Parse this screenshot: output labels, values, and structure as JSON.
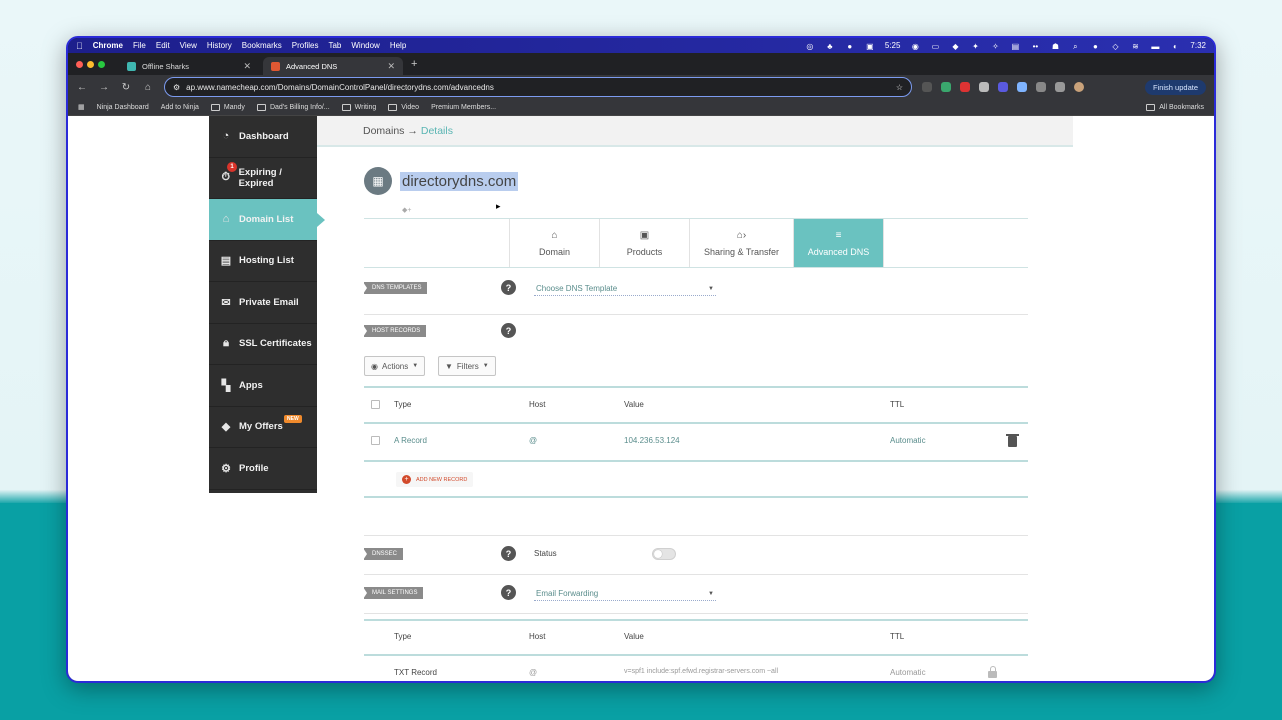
{
  "mac_menu": {
    "app": "Chrome",
    "items": [
      "File",
      "Edit",
      "View",
      "History",
      "Bookmarks",
      "Profiles",
      "Tab",
      "Window",
      "Help"
    ],
    "battery_time": "5:25",
    "clock": "7:32"
  },
  "browser": {
    "tabs": [
      {
        "title": "Offline Sharks",
        "active": false
      },
      {
        "title": "Advanced DNS",
        "active": true
      }
    ],
    "url": "ap.www.namecheap.com/Domains/DomainControlPanel/directorydns.com/advancedns",
    "finish_update": "Finish update",
    "bookmarks": [
      "Ninja Dashboard",
      "Add to Ninja",
      "Mandy",
      "Dad's Billing Info/...",
      "Writing",
      "Video",
      "Premium Members..."
    ],
    "all_bookmarks": "All Bookmarks"
  },
  "sidebar": {
    "items": [
      {
        "label": "Dashboard",
        "icon": "gauge-icon"
      },
      {
        "label": "Expiring / Expired",
        "icon": "timer-icon",
        "badge": "1"
      },
      {
        "label": "Domain List",
        "icon": "home-icon",
        "active": true
      },
      {
        "label": "Hosting List",
        "icon": "server-icon"
      },
      {
        "label": "Private Email",
        "icon": "envelope-icon"
      },
      {
        "label": "SSL Certificates",
        "icon": "lock-icon"
      },
      {
        "label": "Apps",
        "icon": "apps-icon"
      },
      {
        "label": "My Offers",
        "icon": "tag-icon",
        "badge": "NEW"
      },
      {
        "label": "Profile",
        "icon": "gear-icon"
      }
    ]
  },
  "header": {
    "breadcrumb_root": "Domains →",
    "breadcrumb_current": "Details"
  },
  "domain": {
    "name": "directorydns.com"
  },
  "domain_tabs": [
    {
      "label": "Domain",
      "icon": "home-icon"
    },
    {
      "label": "Products",
      "icon": "box-icon"
    },
    {
      "label": "Sharing & Transfer",
      "icon": "share-icon"
    },
    {
      "label": "Advanced DNS",
      "icon": "server-stack-icon",
      "active": true
    }
  ],
  "dns_templates": {
    "label": "DNS TEMPLATES",
    "select_value": "Choose DNS Template"
  },
  "host_records": {
    "label": "HOST RECORDS",
    "actions_label": "Actions",
    "filters_label": "Filters",
    "columns": [
      "Type",
      "Host",
      "Value",
      "TTL"
    ],
    "rows": [
      {
        "type": "A Record",
        "host": "@",
        "value": "104.236.53.124",
        "ttl": "Automatic"
      }
    ],
    "add_new": "ADD NEW RECORD"
  },
  "dnssec": {
    "label": "DNSSEC",
    "status_label": "Status"
  },
  "mail_settings": {
    "label": "MAIL SETTINGS",
    "select_value": "Email Forwarding",
    "columns": [
      "Type",
      "Host",
      "Value",
      "TTL"
    ],
    "rows": [
      {
        "type": "TXT Record",
        "host": "@",
        "value": "v=spf1 include:spf.efwd.registrar-servers.com ~all",
        "ttl": "Automatic"
      }
    ]
  }
}
